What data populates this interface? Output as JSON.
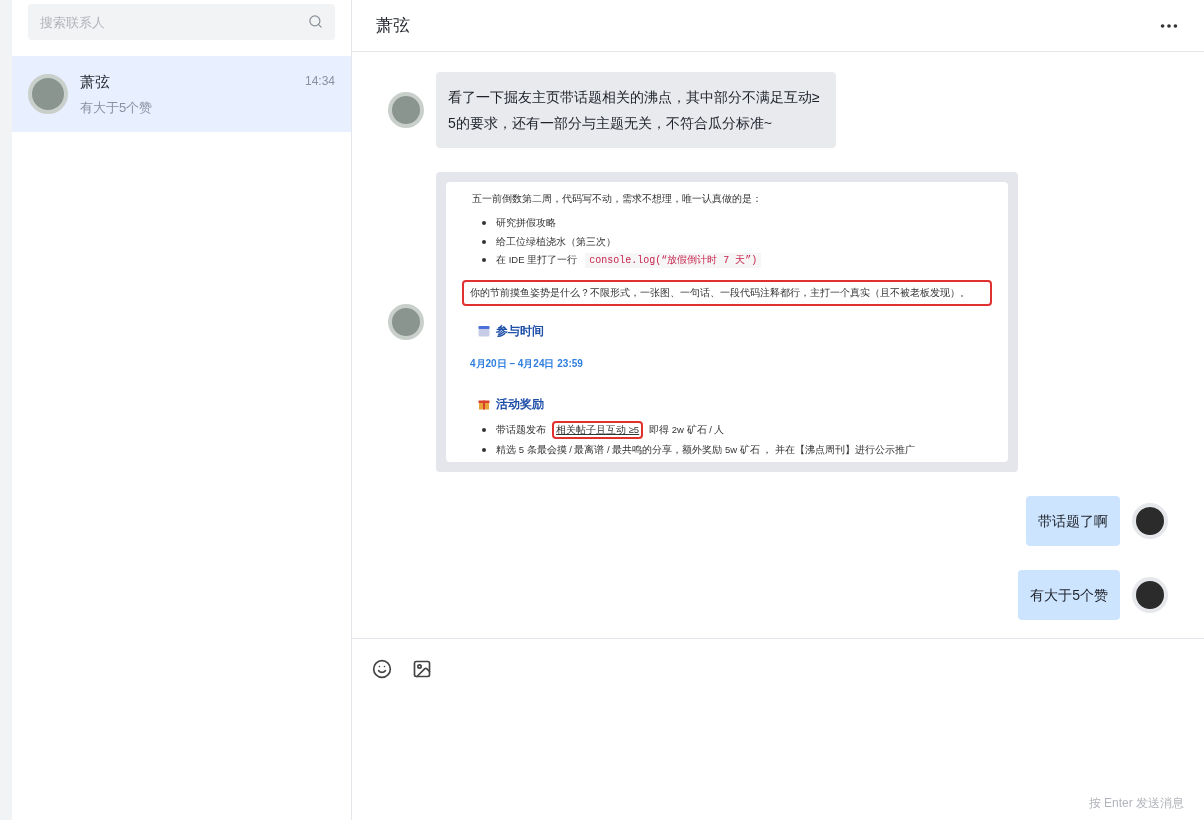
{
  "sidebar": {
    "search": {
      "placeholder": "搜索联系人"
    },
    "contacts": [
      {
        "name": "萧弦",
        "preview": "有大于5个赞",
        "time": "14:34",
        "selected": true
      }
    ]
  },
  "chat": {
    "title": "萧弦",
    "messages": [
      {
        "kind": "text",
        "outgoing": false,
        "text": "看了一下掘友主页带话题相关的沸点，其中部分不满足互动≥ 5的要求，还有一部分与主题无关，不符合瓜分标准~"
      },
      {
        "kind": "image",
        "outgoing": false,
        "blocks": [
          {
            "kind": "paragraph",
            "boxed": false,
            "text": "五一前倒数第二周，代码写不动，需求不想理，唯一认真做的是："
          },
          {
            "kind": "bullets",
            "items": [
              [
                {
                  "kind": "text",
                  "text": "研究拼假攻略"
                }
              ],
              [
                {
                  "kind": "text",
                  "text": "给工位绿植浇水（第三次）"
                }
              ],
              [
                {
                  "kind": "text",
                  "text": "在 IDE 里打了一行"
                },
                {
                  "kind": "code",
                  "text": "console.log(“放假倒计时 7 天”)"
                }
              ]
            ]
          },
          {
            "kind": "paragraph",
            "boxed": true,
            "text": "你的节前摸鱼姿势是什么？不限形式，一张图、一句话、一段代码注释都行，主打一个真实（且不被老板发现）。"
          },
          {
            "kind": "heading",
            "text": "参与时间"
          },
          {
            "kind": "date",
            "text": "4月20日 – 4月24日 23:59"
          },
          {
            "kind": "heading",
            "text": "活动奖励"
          },
          {
            "kind": "bullets",
            "items": [
              [
                {
                  "kind": "text",
                  "text": "带话题发布"
                },
                {
                  "kind": "boxed",
                  "text": "相关帖子且互动 ≥5"
                },
                {
                  "kind": "text",
                  "text": "即得 2w 矿石 / 人"
                }
              ],
              [
                {
                  "kind": "text",
                  "text": "精选 5 条最会摸 / 最离谱 / 最共鸣的分享，额外奖励 5w 矿石 ， 并在【沸点周刊】进行公示推广"
                }
              ]
            ]
          }
        ]
      },
      {
        "kind": "text",
        "outgoing": true,
        "text": "带话题了啊"
      },
      {
        "kind": "text",
        "outgoing": true,
        "text": "有大于5个赞"
      }
    ],
    "composer": {
      "hint": "按 Enter 发送消息"
    }
  }
}
